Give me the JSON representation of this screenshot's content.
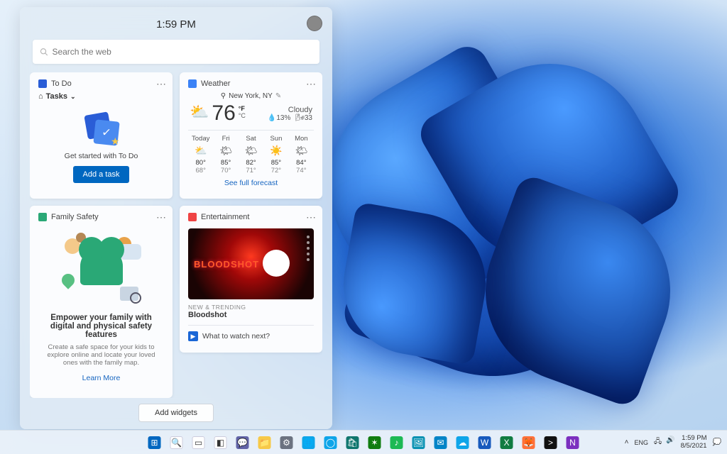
{
  "panel": {
    "time": "1:59 PM",
    "search_placeholder": "Search the web",
    "add_widgets": "Add widgets"
  },
  "todo": {
    "title": "To Do",
    "tasks_label": "Tasks",
    "caption": "Get started with To Do",
    "button": "Add a task"
  },
  "weather": {
    "title": "Weather",
    "location": "New York, NY",
    "temp": "76",
    "unit_f": "°F",
    "unit_c": "°C",
    "condition": "Cloudy",
    "humidity": "13%",
    "wind": "33",
    "link": "See full forecast",
    "days": [
      {
        "name": "Today",
        "icon": "⛅",
        "hi": "80°",
        "lo": "68°"
      },
      {
        "name": "Fri",
        "icon": "🌤",
        "hi": "85°",
        "lo": "70°"
      },
      {
        "name": "Sat",
        "icon": "🌤",
        "hi": "82°",
        "lo": "71°"
      },
      {
        "name": "Sun",
        "icon": "☀️",
        "hi": "85°",
        "lo": "72°"
      },
      {
        "name": "Mon",
        "icon": "🌤",
        "hi": "84°",
        "lo": "74°"
      }
    ]
  },
  "family": {
    "title": "Family Safety",
    "headline": "Empower your family with digital and physical safety features",
    "desc": "Create a safe space for your kids to explore online and locate your loved ones with the family map.",
    "link": "Learn More"
  },
  "ent": {
    "title": "Entertainment",
    "poster_text": "BLOODSHOT",
    "tag": "NEW & TRENDING",
    "movie": "Bloodshot",
    "next": "What to watch next?"
  },
  "taskbar": {
    "icons": [
      {
        "name": "start",
        "bg": "#0067c0",
        "glyph": "⊞"
      },
      {
        "name": "search",
        "bg": "#ffffff",
        "glyph": "🔍"
      },
      {
        "name": "task-view",
        "bg": "#ffffff",
        "glyph": "▭"
      },
      {
        "name": "widgets",
        "bg": "#ffffff",
        "glyph": "◧"
      },
      {
        "name": "chat",
        "bg": "#6264a7",
        "glyph": "💬"
      },
      {
        "name": "explorer",
        "bg": "#f7c948",
        "glyph": "📁"
      },
      {
        "name": "settings",
        "bg": "#6b7280",
        "glyph": "⚙"
      },
      {
        "name": "edge",
        "bg": "#0ea5e9",
        "glyph": "🌐"
      },
      {
        "name": "cortana",
        "bg": "#0ea5e9",
        "glyph": "◯"
      },
      {
        "name": "store",
        "bg": "#0f766e",
        "glyph": "🛍"
      },
      {
        "name": "xbox",
        "bg": "#107c10",
        "glyph": "✶"
      },
      {
        "name": "spotify",
        "bg": "#1db954",
        "glyph": "♪"
      },
      {
        "name": "photos",
        "bg": "#0891b2",
        "glyph": "🖼"
      },
      {
        "name": "mail",
        "bg": "#0284c7",
        "glyph": "✉"
      },
      {
        "name": "onedrive",
        "bg": "#0ea5e9",
        "glyph": "☁"
      },
      {
        "name": "word",
        "bg": "#185abd",
        "glyph": "W"
      },
      {
        "name": "excel",
        "bg": "#107c41",
        "glyph": "X"
      },
      {
        "name": "firefox",
        "bg": "#ff7139",
        "glyph": "🦊"
      },
      {
        "name": "terminal",
        "bg": "#111111",
        "glyph": ">"
      },
      {
        "name": "onenote",
        "bg": "#7b2fbf",
        "glyph": "N"
      }
    ]
  },
  "tray": {
    "chevron": "˄",
    "lang": "ENG",
    "time": "1:59 PM",
    "date": "8/5/2021"
  }
}
